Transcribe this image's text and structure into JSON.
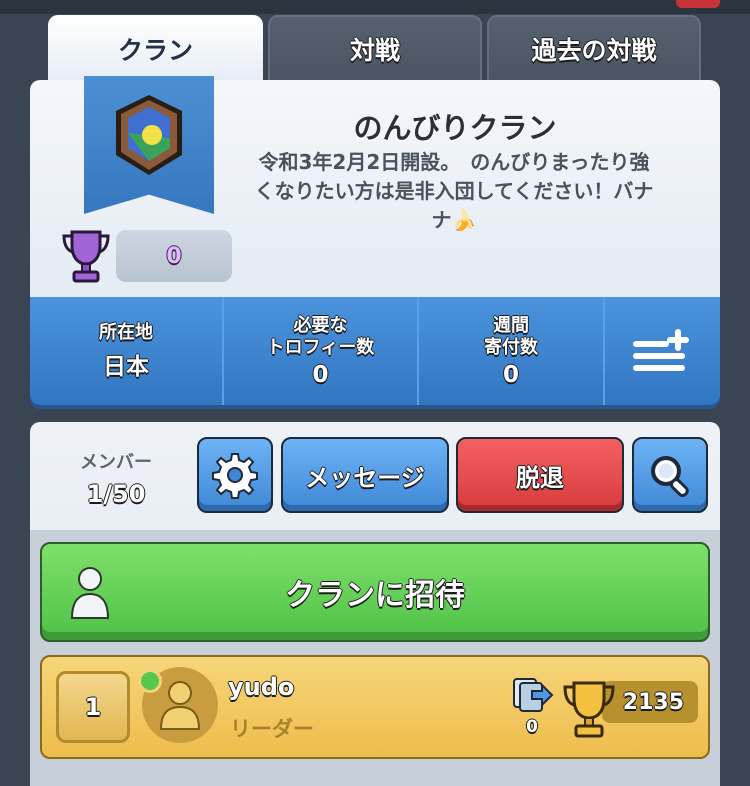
{
  "tabs": [
    {
      "label": "クラン",
      "active": true
    },
    {
      "label": "対戦",
      "active": false
    },
    {
      "label": "過去の対戦",
      "active": false
    }
  ],
  "clan": {
    "name": "のんびりクラン",
    "description": "令和3年2月2日開設。　のんびりまったり強くなりたい方は是非入団してください！バナナ🍌",
    "trophies": "0"
  },
  "stats": {
    "location_label": "所在地",
    "location_value": "日本",
    "required_trophies_label": "必要な\nトロフィー数",
    "required_trophies_value": "0",
    "weekly_donations_label": "週間\n寄付数",
    "weekly_donations_value": "0"
  },
  "members": {
    "label": "メンバー",
    "count": "1/50"
  },
  "actions": {
    "message_label": "メッセージ",
    "leave_label": "脱退",
    "invite_label": "クランに招待"
  },
  "member_list": [
    {
      "rank": "1",
      "name": "yudo",
      "role": "リーダー",
      "donations": "0",
      "trophies": "2135"
    }
  ],
  "colors": {
    "blue_bar": "#3f86d2",
    "green_button": "#5fcf52",
    "red_button": "#e04a4c",
    "leader_row": "#f2c75d"
  }
}
